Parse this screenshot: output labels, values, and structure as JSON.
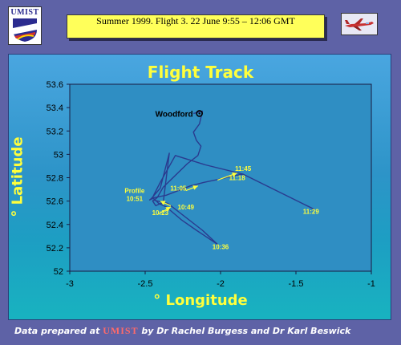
{
  "header": {
    "title": "Summer 1999.   Flight 3.   22 June  9:55 – 12:06 GMT"
  },
  "logo": {
    "text": "UMIST"
  },
  "chart_data": {
    "type": "line",
    "title": "Flight Track",
    "xlabel": "° Longitude",
    "ylabel": "° Latitude",
    "xlim": [
      -3,
      -1
    ],
    "ylim": [
      52,
      53.6
    ],
    "xticks": [
      "-3",
      "-2.5",
      "-2",
      "-1.5",
      "-1"
    ],
    "yticks": [
      "52",
      "52.2",
      "52.4",
      "52.6",
      "52.8",
      "53",
      "53.2",
      "53.4",
      "53.6"
    ],
    "series": [
      {
        "x": [
          -2.18,
          -2.12,
          -2.14,
          -2.18,
          -2.16,
          -2.13,
          -2.15,
          -2.22,
          -2.3,
          -2.38,
          -2.42,
          -2.45,
          -2.43,
          -2.38,
          -2.34,
          -2.4,
          -2.46,
          -2.47,
          -2.44,
          -2.36,
          -2.3,
          -2.2,
          -2.11,
          -2.0,
          -1.9,
          -1.85,
          -1.38,
          -1.85,
          -2.1,
          -2.3,
          -2.4,
          -2.44,
          -2.45,
          -2.41,
          -2.36,
          -2.26,
          -2.16,
          -2.02,
          -2.12,
          -2.35,
          -2.45
        ],
        "y": [
          53.35,
          53.37,
          53.26,
          53.19,
          53.12,
          53.07,
          52.99,
          52.92,
          52.82,
          52.72,
          52.63,
          52.6,
          52.56,
          52.59,
          53.01,
          52.71,
          52.62,
          52.61,
          52.63,
          52.65,
          52.68,
          52.73,
          52.76,
          52.79,
          52.82,
          52.83,
          52.53,
          52.83,
          52.91,
          52.99,
          52.76,
          52.66,
          52.63,
          52.58,
          52.55,
          52.44,
          52.35,
          52.23,
          52.35,
          52.58,
          52.61
        ]
      }
    ],
    "points": [
      {
        "label": "Woodford",
        "x": -2.14,
        "y": 53.35
      }
    ],
    "annotations": [
      {
        "text": "11:45",
        "x": -1.85,
        "y": 52.86
      },
      {
        "text": "11:18",
        "x": -1.89,
        "y": 52.78
      },
      {
        "text": "11:29",
        "x": -1.4,
        "y": 52.49
      },
      {
        "text": "11:05",
        "x": -2.28,
        "y": 52.69
      },
      {
        "text": "Profile",
        "x": -2.57,
        "y": 52.67
      },
      {
        "text": "10:51",
        "x": -2.57,
        "y": 52.6
      },
      {
        "text": "10:49",
        "x": -2.23,
        "y": 52.53
      },
      {
        "text": "10:23",
        "x": -2.4,
        "y": 52.48
      },
      {
        "text": "10:36",
        "x": -2.0,
        "y": 52.19
      }
    ],
    "arrows": [
      {
        "x": [
          -2.02,
          -1.89
        ],
        "y": [
          52.78,
          52.84
        ]
      },
      {
        "x": [
          -2.23,
          -2.15
        ],
        "y": [
          52.69,
          52.73
        ]
      },
      {
        "x": [
          -2.33,
          -2.4
        ],
        "y": [
          52.56,
          52.6
        ]
      },
      {
        "x": [
          -2.41,
          -2.33
        ],
        "y": [
          52.49,
          52.55
        ]
      }
    ]
  },
  "footer": {
    "prefix": "Data prepared at ",
    "org": "UMIST",
    "suffix": " by Dr Rachel Burgess and Dr Karl Beswick"
  },
  "colors": {
    "background": "#5e62a6",
    "accent_yellow": "#ffff3c",
    "track": "#2a3b8f",
    "header_box": "#ffff5a"
  }
}
